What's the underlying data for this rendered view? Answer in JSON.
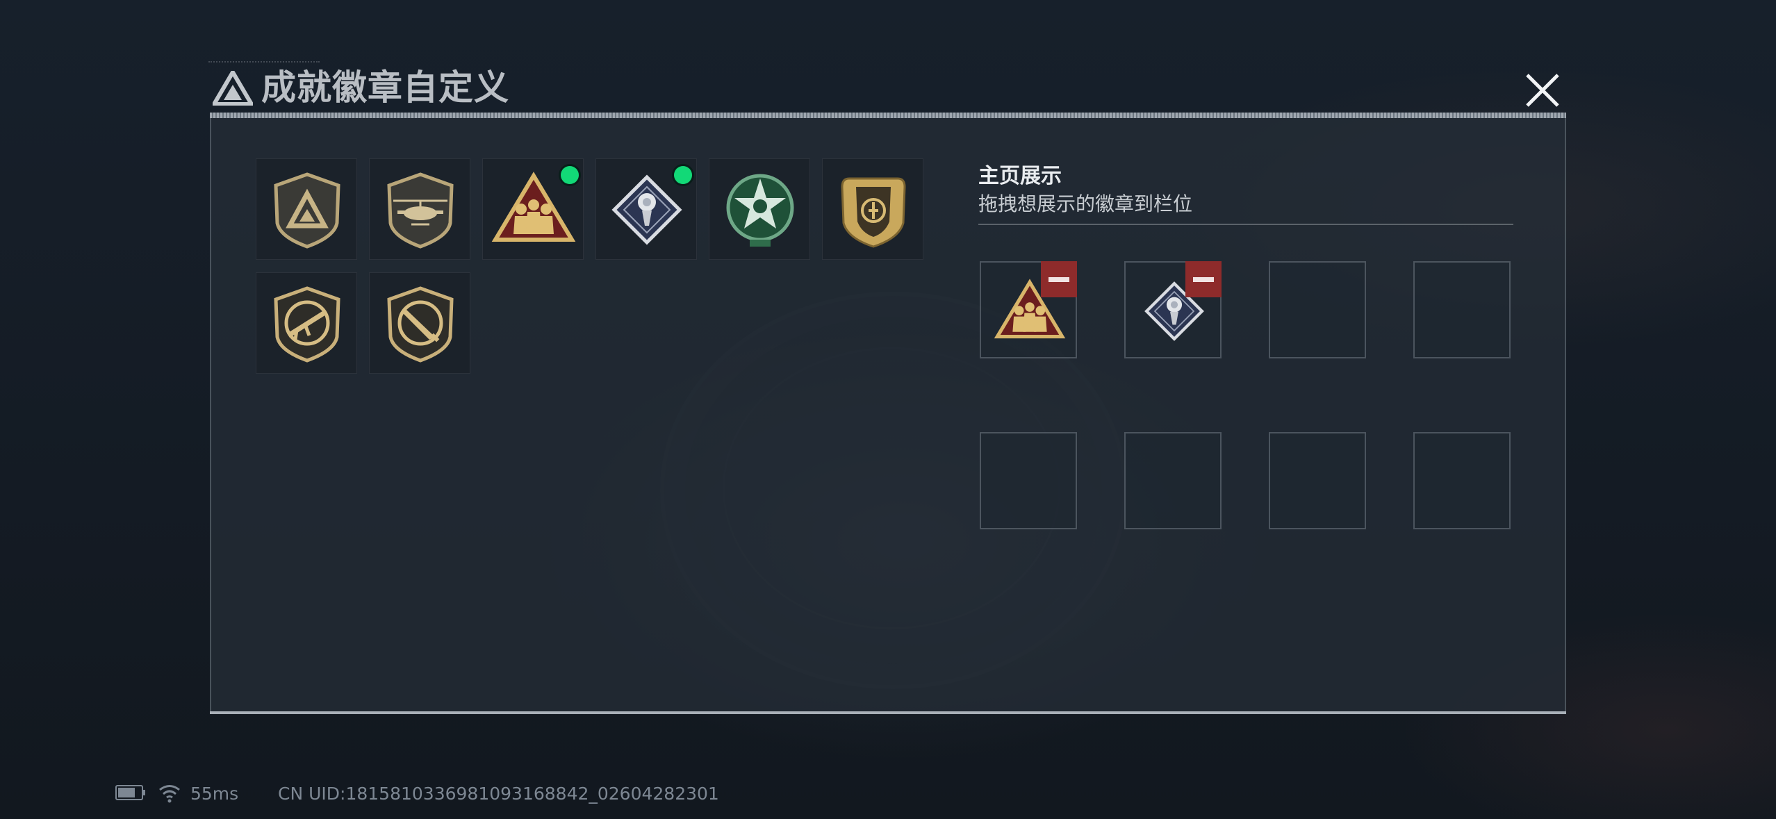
{
  "window": {
    "title": "成就徽章自定义",
    "close_icon": "close-icon"
  },
  "badges": [
    {
      "name": "triangle-logo-shield-badge",
      "new": false
    },
    {
      "name": "helicopter-shield-badge",
      "new": false
    },
    {
      "name": "soldiers-triangle-badge",
      "new": true
    },
    {
      "name": "rose-diamond-badge",
      "new": true
    },
    {
      "name": "green-star-emblem-badge",
      "new": false
    },
    {
      "name": "gold-crest-badge",
      "new": false
    },
    {
      "name": "rifle-shield-badge",
      "new": false
    },
    {
      "name": "knife-shield-badge",
      "new": false
    }
  ],
  "showcase": {
    "title": "主页展示",
    "subtitle": "拖拽想展示的徽章到栏位",
    "slots": [
      {
        "badge": "soldiers-triangle-badge",
        "removable": true
      },
      {
        "badge": "rose-diamond-badge",
        "removable": true
      },
      {
        "badge": null,
        "removable": false
      },
      {
        "badge": null,
        "removable": false
      },
      {
        "badge": null,
        "removable": false
      },
      {
        "badge": null,
        "removable": false
      },
      {
        "badge": null,
        "removable": false
      },
      {
        "badge": null,
        "removable": false
      }
    ]
  },
  "status_bar": {
    "battery_icon": "battery-icon",
    "wifi_icon": "wifi-icon",
    "ping": "55ms",
    "uid": "CN UID:1815810336981093168842_02604282301"
  },
  "colors": {
    "accent_new": "#12d977",
    "remove": "#8e2b2b",
    "gold": "#c9a85c"
  }
}
